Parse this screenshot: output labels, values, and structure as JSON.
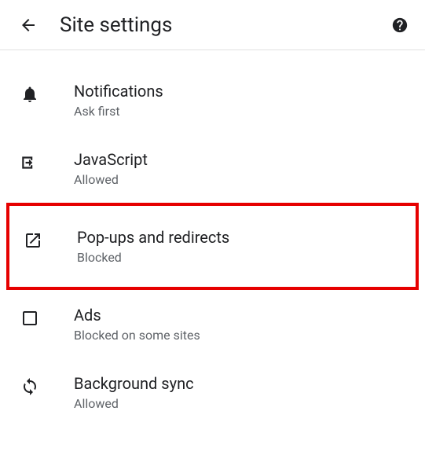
{
  "header": {
    "title": "Site settings"
  },
  "settings": {
    "notifications": {
      "title": "Notifications",
      "subtitle": "Ask first"
    },
    "javascript": {
      "title": "JavaScript",
      "subtitle": "Allowed"
    },
    "popups": {
      "title": "Pop-ups and redirects",
      "subtitle": "Blocked"
    },
    "ads": {
      "title": "Ads",
      "subtitle": "Blocked on some sites"
    },
    "backgroundsync": {
      "title": "Background sync",
      "subtitle": "Allowed"
    }
  }
}
